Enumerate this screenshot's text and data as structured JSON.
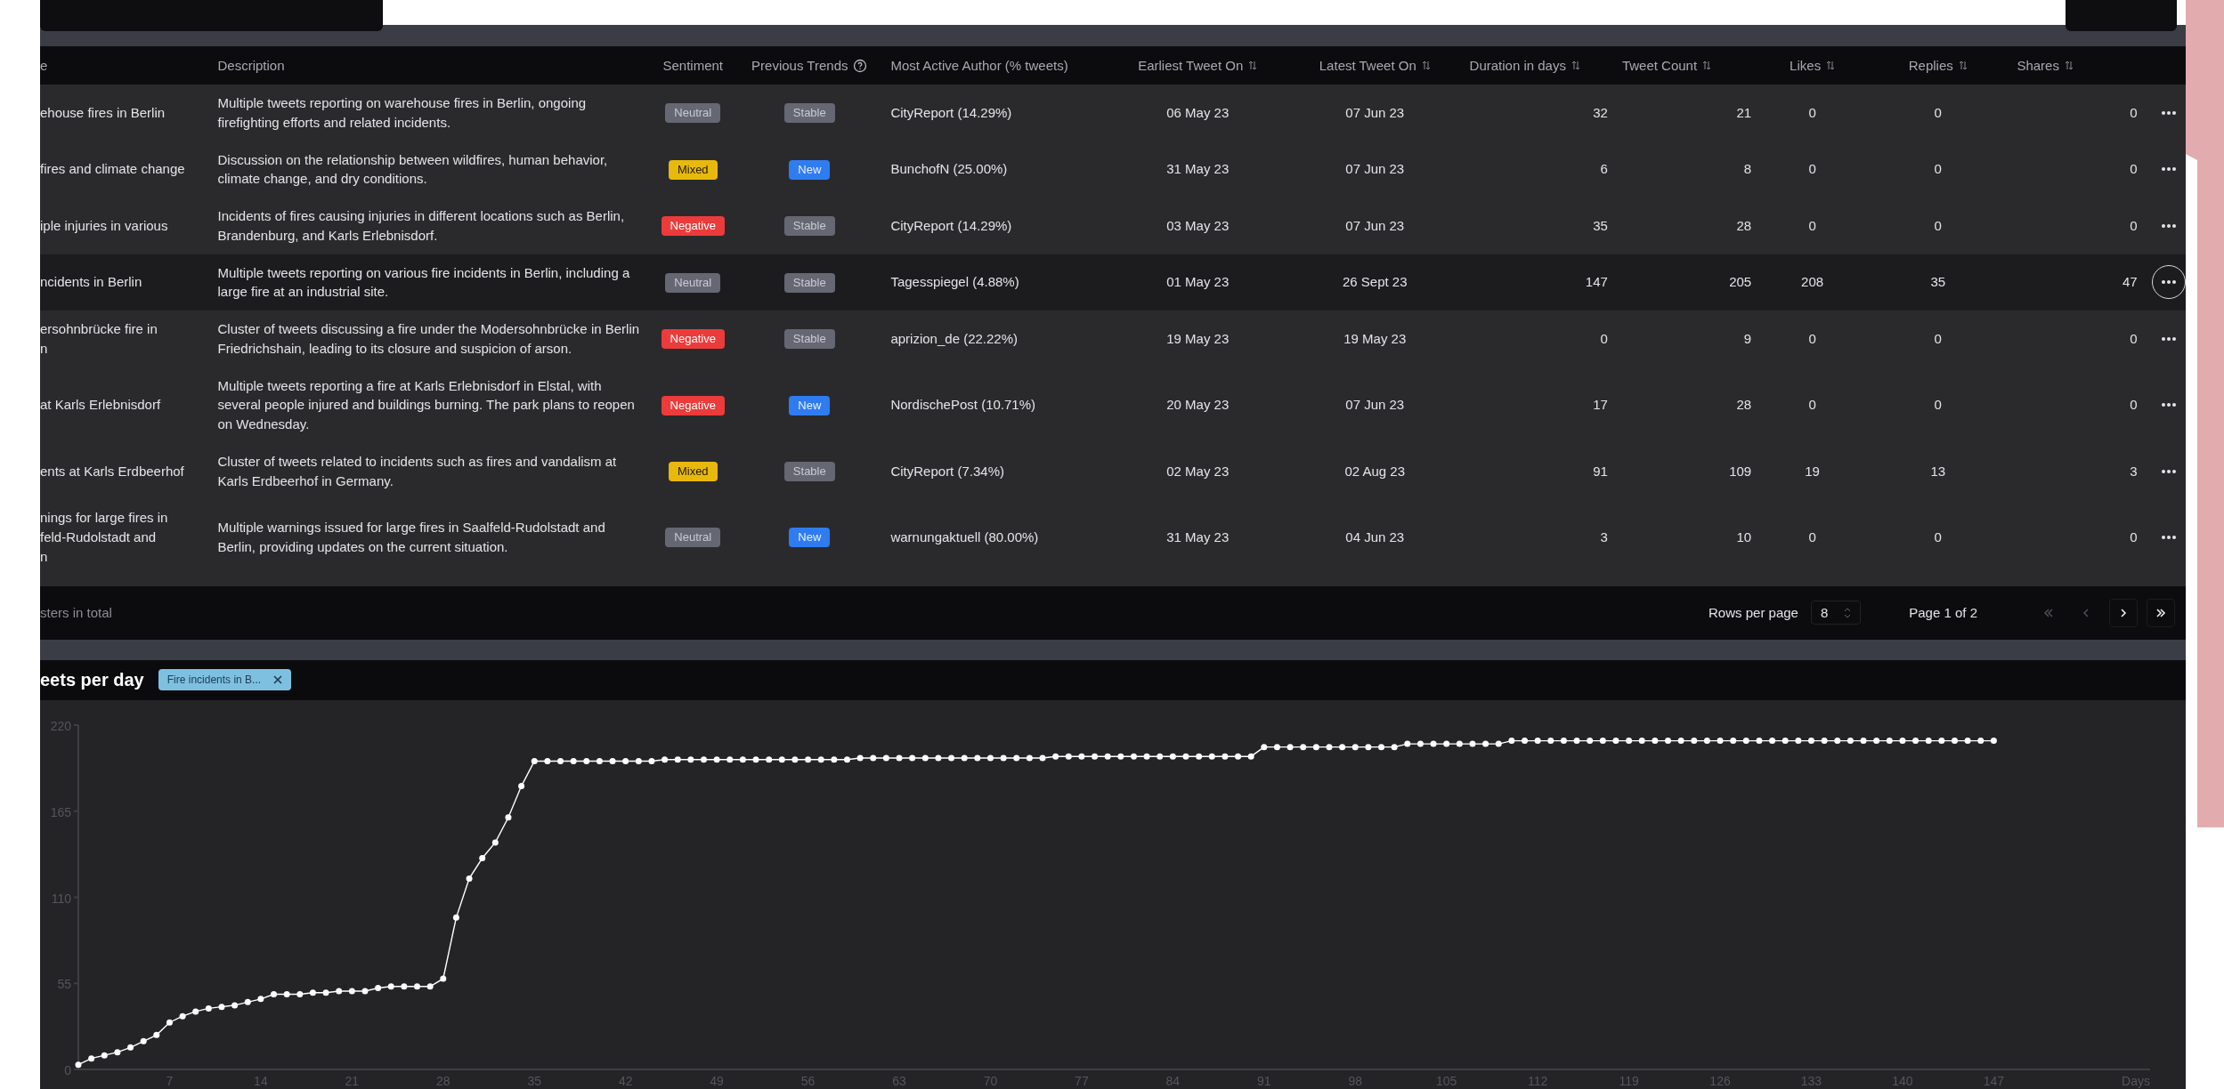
{
  "table": {
    "columns": [
      {
        "label": "e",
        "sortable": false,
        "help": false
      },
      {
        "label": "Description",
        "sortable": false,
        "help": false
      },
      {
        "label": "Sentiment",
        "sortable": false,
        "help": false
      },
      {
        "label": "Previous Trends",
        "sortable": false,
        "help": true
      },
      {
        "label": "Most Active Author (% tweets)",
        "sortable": false,
        "help": false
      },
      {
        "label": "Earliest Tweet On",
        "sortable": true,
        "help": false
      },
      {
        "label": "Latest Tweet On",
        "sortable": true,
        "help": false
      },
      {
        "label": "Duration in days",
        "sortable": true,
        "help": false
      },
      {
        "label": "Tweet Count",
        "sortable": true,
        "help": false
      },
      {
        "label": "Likes",
        "sortable": true,
        "help": false
      },
      {
        "label": "Replies",
        "sortable": true,
        "help": false
      },
      {
        "label": "Shares",
        "sortable": true,
        "help": false
      }
    ],
    "rows": [
      {
        "name": "ehouse fires in Berlin",
        "description": "Multiple tweets reporting on warehouse fires in Berlin, ongoing firefighting efforts and related incidents.",
        "sentiment": {
          "label": "Neutral",
          "kind": "neutral"
        },
        "trend": {
          "label": "Stable",
          "kind": "stable"
        },
        "author": "CityReport (14.29%)",
        "earliest": "06 May 23",
        "latest": "07 Jun 23",
        "duration": "32",
        "tweet_count": "21",
        "likes": "0",
        "replies": "0",
        "shares": "0",
        "selected": false
      },
      {
        "name": "fires and climate change",
        "description": "Discussion on the relationship between wildfires, human behavior, climate change, and dry conditions.",
        "sentiment": {
          "label": "Mixed",
          "kind": "mixed"
        },
        "trend": {
          "label": "New",
          "kind": "new"
        },
        "author": "BunchofN (25.00%)",
        "earliest": "31 May 23",
        "latest": "07 Jun 23",
        "duration": "6",
        "tweet_count": "8",
        "likes": "0",
        "replies": "0",
        "shares": "0",
        "selected": false
      },
      {
        "name": "iple injuries in various",
        "description": "Incidents of fires causing injuries in different locations such as Berlin, Brandenburg, and Karls Erlebnisdorf.",
        "sentiment": {
          "label": "Negative",
          "kind": "negative"
        },
        "trend": {
          "label": "Stable",
          "kind": "stable"
        },
        "author": "CityReport (14.29%)",
        "earliest": "03 May 23",
        "latest": "07 Jun 23",
        "duration": "35",
        "tweet_count": "28",
        "likes": "0",
        "replies": "0",
        "shares": "0",
        "selected": false
      },
      {
        "name": "ncidents in Berlin",
        "description": "Multiple tweets reporting on various fire incidents in Berlin, including a large fire at an industrial site.",
        "sentiment": {
          "label": "Neutral",
          "kind": "neutral"
        },
        "trend": {
          "label": "Stable",
          "kind": "stable"
        },
        "author": "Tagesspiegel (4.88%)",
        "earliest": "01 May 23",
        "latest": "26 Sept 23",
        "duration": "147",
        "tweet_count": "205",
        "likes": "208",
        "replies": "35",
        "shares": "47",
        "selected": true
      },
      {
        "name": "ersohnbrücke fire in\nn",
        "description": "Cluster of tweets discussing a fire under the Modersohnbrücke in Berlin Friedrichshain, leading to its closure and suspicion of arson.",
        "sentiment": {
          "label": "Negative",
          "kind": "negative"
        },
        "trend": {
          "label": "Stable",
          "kind": "stable"
        },
        "author": "aprizion_de (22.22%)",
        "earliest": "19 May 23",
        "latest": "19 May 23",
        "duration": "0",
        "tweet_count": "9",
        "likes": "0",
        "replies": "0",
        "shares": "0",
        "selected": false
      },
      {
        "name": "at Karls Erlebnisdorf",
        "description": "Multiple tweets reporting a fire at Karls Erlebnisdorf in Elstal, with several people injured and buildings burning. The park plans to reopen on Wednesday.",
        "sentiment": {
          "label": "Negative",
          "kind": "negative"
        },
        "trend": {
          "label": "New",
          "kind": "new"
        },
        "author": "NordischePost (10.71%)",
        "earliest": "20 May 23",
        "latest": "07 Jun 23",
        "duration": "17",
        "tweet_count": "28",
        "likes": "0",
        "replies": "0",
        "shares": "0",
        "selected": false
      },
      {
        "name": "ents at Karls Erdbeerhof",
        "description": "Cluster of tweets related to incidents such as fires and vandalism at Karls Erdbeerhof in Germany.",
        "sentiment": {
          "label": "Mixed",
          "kind": "mixed"
        },
        "trend": {
          "label": "Stable",
          "kind": "stable"
        },
        "author": "CityReport (7.34%)",
        "earliest": "02 May 23",
        "latest": "02 Aug 23",
        "duration": "91",
        "tweet_count": "109",
        "likes": "19",
        "replies": "13",
        "shares": "3",
        "selected": false
      },
      {
        "name": "nings for large fires in\nfeld-Rudolstadt and\nn",
        "description": "Multiple warnings issued for large fires in Saalfeld-Rudolstadt and Berlin, providing updates on the current situation.",
        "sentiment": {
          "label": "Neutral",
          "kind": "neutral"
        },
        "trend": {
          "label": "New",
          "kind": "new"
        },
        "author": "warnungaktuell (80.00%)",
        "earliest": "31 May 23",
        "latest": "04 Jun 23",
        "duration": "3",
        "tweet_count": "10",
        "likes": "0",
        "replies": "0",
        "shares": "0",
        "selected": false
      }
    ],
    "footer": {
      "total": "sters in total",
      "rows_per_page_label": "Rows per page",
      "rows_per_page": "8",
      "page": "Page 1 of 2",
      "pager": [
        {
          "kind": "first",
          "disabled": true
        },
        {
          "kind": "prev",
          "disabled": true
        },
        {
          "kind": "next",
          "disabled": false
        },
        {
          "kind": "last",
          "disabled": false
        }
      ]
    }
  },
  "chart_panel": {
    "title": "eets per day",
    "filter_chip": "Fire incidents in B...",
    "chart_data": {
      "type": "line",
      "xlabel": "Days",
      "xlim": [
        0,
        159
      ],
      "ylim": [
        0,
        220
      ],
      "x": [
        0,
        1,
        2,
        3,
        4,
        5,
        6,
        7,
        8,
        9,
        10,
        11,
        12,
        13,
        14,
        15,
        16,
        17,
        18,
        19,
        20,
        21,
        22,
        23,
        24,
        25,
        26,
        27,
        28,
        29,
        30,
        31,
        32,
        33,
        34,
        35,
        36,
        37,
        38,
        39,
        40,
        41,
        42,
        43,
        44,
        45,
        46,
        47,
        48,
        49,
        50,
        51,
        52,
        53,
        54,
        55,
        56,
        57,
        58,
        59,
        60,
        61,
        62,
        63,
        64,
        65,
        66,
        67,
        68,
        69,
        70,
        71,
        72,
        73,
        74,
        75,
        76,
        77,
        78,
        79,
        80,
        81,
        82,
        83,
        84,
        85,
        86,
        87,
        88,
        89,
        90,
        91,
        92,
        93,
        94,
        95,
        96,
        97,
        98,
        99,
        100,
        101,
        102,
        103,
        104,
        105,
        106,
        107,
        108,
        109,
        110,
        111,
        112,
        113,
        114,
        115,
        116,
        117,
        118,
        119,
        120,
        121,
        122,
        123,
        124,
        125,
        126,
        127,
        128,
        129,
        130,
        131,
        132,
        133,
        134,
        135,
        136,
        137,
        138,
        139,
        140,
        141,
        142,
        143,
        144,
        145,
        146,
        147
      ],
      "xticks": [
        7,
        14,
        21,
        28,
        35,
        42,
        49,
        56,
        63,
        70,
        77,
        84,
        91,
        98,
        105,
        112,
        119,
        126,
        133,
        140,
        147
      ],
      "yticks": [
        0,
        55,
        110,
        165,
        220
      ],
      "series": [
        {
          "color": "#ffffff",
          "marker": "circle",
          "values": [
            3,
            7,
            9,
            11,
            14,
            18,
            22,
            30,
            34,
            37,
            39,
            40,
            41,
            43,
            45,
            48,
            48,
            48,
            49,
            49,
            50,
            50,
            50,
            52,
            53,
            53,
            53,
            53,
            58,
            97,
            122,
            135,
            145,
            161,
            181,
            197,
            197,
            197,
            197,
            197,
            197,
            197,
            197,
            197,
            197,
            198,
            198,
            198,
            198,
            198,
            198,
            198,
            198,
            198,
            198,
            198,
            198,
            198,
            198,
            198,
            199,
            199,
            199,
            199,
            199,
            199,
            199,
            199,
            199,
            199,
            199,
            199,
            199,
            199,
            199,
            200,
            200,
            200,
            200,
            200,
            200,
            200,
            200,
            200,
            200,
            200,
            200,
            200,
            200,
            200,
            200,
            206,
            206,
            206,
            206,
            206,
            206,
            206,
            206,
            206,
            206,
            206,
            208,
            208,
            208,
            208,
            208,
            208,
            208,
            208,
            210,
            210,
            210,
            210,
            210,
            210,
            210,
            210,
            210,
            210,
            210,
            210,
            210,
            210,
            210,
            210,
            210,
            210,
            210,
            210,
            210,
            210,
            210,
            210,
            210,
            210,
            210,
            210,
            210,
            210,
            210,
            210,
            210,
            210,
            210,
            210,
            210,
            210
          ]
        }
      ]
    }
  }
}
